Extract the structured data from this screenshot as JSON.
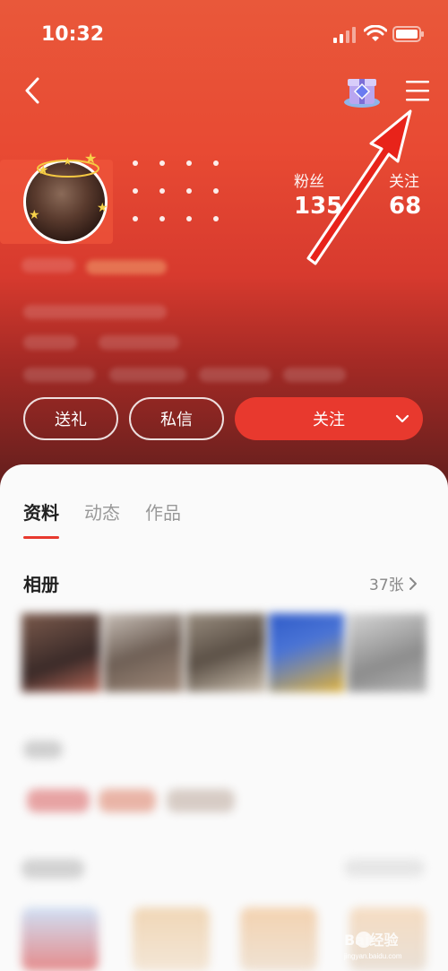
{
  "status_bar": {
    "time": "10:32"
  },
  "profile": {
    "fans_label": "粉丝",
    "fans_value": "135",
    "follow_label": "关注",
    "follow_value": "68"
  },
  "actions": {
    "gift_label": "送礼",
    "message_label": "私信",
    "follow_label": "关注"
  },
  "tabs": [
    {
      "label": "资料",
      "active": true
    },
    {
      "label": "动态",
      "active": false
    },
    {
      "label": "作品",
      "active": false
    }
  ],
  "album": {
    "title": "相册",
    "count": "37张"
  },
  "watermark": {
    "brand": "Bai经验",
    "url": "jingyan.baidu.com"
  },
  "colors": {
    "accent": "#e8392e",
    "header_top": "#e9583a",
    "header_bottom": "#5a1d1c"
  }
}
